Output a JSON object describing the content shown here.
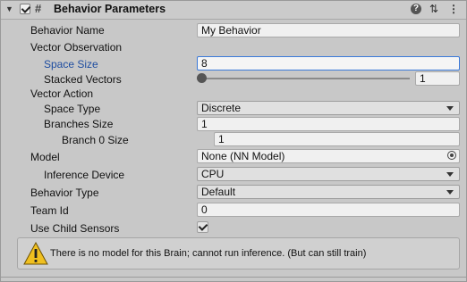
{
  "component": {
    "title": "Behavior Parameters",
    "enabled": true
  },
  "fields": {
    "behavior_name": {
      "label": "Behavior Name",
      "value": "My Behavior"
    },
    "vector_observation": {
      "label": "Vector Observation"
    },
    "space_size": {
      "label": "Space Size",
      "value": "8"
    },
    "stacked_vectors": {
      "label": "Stacked Vectors",
      "value": "1",
      "slider_fraction": 0
    },
    "vector_action": {
      "label": "Vector Action"
    },
    "space_type": {
      "label": "Space Type",
      "value": "Discrete"
    },
    "branches_size": {
      "label": "Branches Size",
      "value": "1"
    },
    "branch0_size": {
      "label": "Branch 0 Size",
      "value": "1"
    },
    "model": {
      "label": "Model",
      "value": "None (NN Model)"
    },
    "inference_device": {
      "label": "Inference Device",
      "value": "CPU"
    },
    "behavior_type": {
      "label": "Behavior Type",
      "value": "Default"
    },
    "team_id": {
      "label": "Team Id",
      "value": "0"
    },
    "use_child_sensors": {
      "label": "Use Child Sensors",
      "checked": true
    }
  },
  "help_box": {
    "text": "There is no model for this Brain; cannot run inference. (But can still train)"
  },
  "icons": {
    "header": [
      "foldout-arrow-icon",
      "hash-script-icon",
      "help-icon",
      "preset-icon",
      "more-menu-icon"
    ],
    "warning": "warning-triangle-icon"
  },
  "colors": {
    "focus_border": "#3a79d9",
    "highlight_label": "#1e4da0",
    "warning_yellow": "#f0c020"
  }
}
